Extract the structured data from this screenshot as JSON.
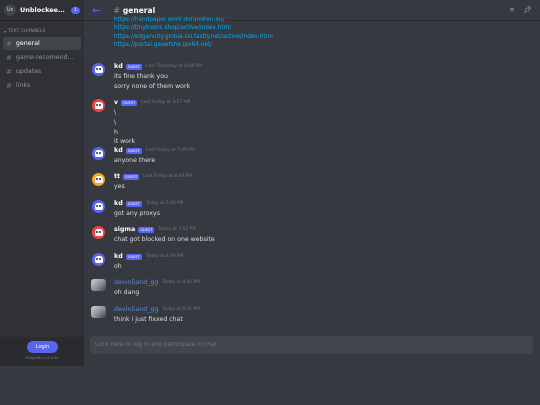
{
  "guild": {
    "icon_text": "Us",
    "name": "Unblockee's ...",
    "badge": "1"
  },
  "sidebar": {
    "category": "TEXT CHANNELS",
    "channels": [
      {
        "label": "general"
      },
      {
        "label": "game-recomendati..."
      },
      {
        "label": "updates"
      },
      {
        "label": "links"
      }
    ],
    "login_label": "Login",
    "version": "WidgetBot v3.9.36"
  },
  "header": {
    "channel": "general"
  },
  "links": [
    "https://handpaper.work.dorandren.eu/",
    "https://tinytrekrc.shop/active/index.html",
    "https://edgenuity.global.ssl.fastly.net/active/index.html",
    "https://portal.qaswfshe.ipx64.net/"
  ],
  "messages": [
    {
      "author": "kd",
      "guest": "GUEST",
      "time": "Last Thursday at 4:04 PM",
      "lines": [
        "its fine thank you",
        "sorry none of them work"
      ],
      "avatar": "blue"
    },
    {
      "author": "v",
      "guest": "GUEST",
      "time": "Last Friday at 3:57 AM",
      "lines": [
        "\\",
        "\\",
        "h",
        "it work"
      ],
      "avatar": "red"
    },
    {
      "author": "kd",
      "guest": "GUEST",
      "time": "Last Friday at 7:49 PM",
      "lines": [
        "anyone there"
      ],
      "avatar": "blue"
    },
    {
      "author": "tt",
      "guest": "GUEST",
      "time": "Last Friday at 8:49 PM",
      "lines": [
        "yes"
      ],
      "avatar": "yellow"
    },
    {
      "author": "kd",
      "guest": "GUEST",
      "time": "Today at 2:49 PM",
      "lines": [
        "got any proxys"
      ],
      "avatar": "blue"
    },
    {
      "author": "sigma",
      "guest": "GUEST",
      "time": "Today at 3:52 PM",
      "lines": [
        "chat got blocked on one website"
      ],
      "avatar": "red"
    },
    {
      "author": "kd",
      "guest": "GUEST",
      "time": "Today at 4:09 PM",
      "lines": [
        "oh"
      ],
      "avatar": "blue"
    },
    {
      "author": "devin5and_gg",
      "guest": "",
      "time": "Today at 9:40 PM",
      "lines": [
        "oh dang"
      ],
      "avatar": "photo"
    },
    {
      "author": "devin5and_gg",
      "guest": "",
      "time": "Today at 9:51 PM",
      "lines": [
        "think i just fixxed chat"
      ],
      "avatar": "photo"
    }
  ],
  "input": {
    "placeholder": "Click here to log in and participate in chat"
  }
}
